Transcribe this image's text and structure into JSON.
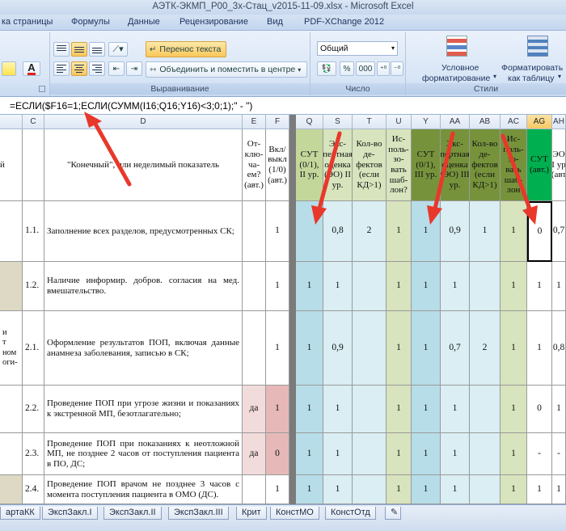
{
  "window": {
    "title": "АЭТК-ЭКМП_Р00_3х-Стац_v2015-11-09.xlsx - Microsoft Excel"
  },
  "ribbon_tabs": [
    "ка страницы",
    "Формулы",
    "Данные",
    "Рецензирование",
    "Вид",
    "PDF-XChange 2012"
  ],
  "ribbon": {
    "wrap_text": "Перенос текста",
    "merge_center": "Объединить и поместить в центре",
    "number_format": "Общий",
    "percent": "%",
    "thousands": "000",
    "cond_format_1": "Условное",
    "cond_format_2": "форматирование",
    "format_table_1": "Форматировать",
    "format_table_2": "как таблицу",
    "group_alignment": "Выравнивание",
    "group_number": "Число",
    "group_styles": "Стили",
    "font_color_letter": "A"
  },
  "formula_bar": {
    "text": "=ЕСЛИ($F16=1;ЕСЛИ(СУММ(I16;Q16;Y16)<3;0;1);\" - \")"
  },
  "columns": [
    {
      "key": "B",
      "label": ""
    },
    {
      "key": "C",
      "label": "C"
    },
    {
      "key": "D",
      "label": "D"
    },
    {
      "key": "E",
      "label": "E"
    },
    {
      "key": "F",
      "label": "F"
    },
    {
      "key": "Q",
      "label": "Q"
    },
    {
      "key": "S",
      "label": "S"
    },
    {
      "key": "T",
      "label": "T"
    },
    {
      "key": "U",
      "label": "U"
    },
    {
      "key": "Y",
      "label": "Y"
    },
    {
      "key": "AA",
      "label": "AA"
    },
    {
      "key": "AB",
      "label": "AB"
    },
    {
      "key": "AC",
      "label": "AC"
    },
    {
      "key": "AG",
      "label": "AG"
    },
    {
      "key": "AH",
      "label": "AH"
    }
  ],
  "header_row": {
    "B": "й",
    "D": "\"Конечный\", или неделимый показатель",
    "E": "От-клю-ча-ем? (авт.)",
    "F": "Вкл/выкл (1/0) (авт.)",
    "Q": "СУТ (0/1), II ур.",
    "S": "Экс-пертная оценка (ЭО) II ур.",
    "T": "Кол-во де-фектов (если КД>1)",
    "U": "Ис-поль-зо-вать шаб-лон?",
    "Y": "СУТ (0/1), III ур.",
    "AA": "Экс-пертная оценка (ЭО) III ур.",
    "AB": "Кол-во де-фектов (если КД>1)",
    "AC": "Ис-поль-зо-вать шаб-лон",
    "AG": "СУТ (авт.)",
    "AH": "ЭО I ур (авт"
  },
  "rows": [
    {
      "B": "",
      "C": "1.1.",
      "D": "Заполнение всех разделов, предусмотренных СК;",
      "E": "",
      "F": "1",
      "Q": "",
      "S": "0,8",
      "T": "2",
      "U": "1",
      "Y": "1",
      "AA": "0,9",
      "AB": "1",
      "AC": "1",
      "AG": "0",
      "AH": "0,7"
    },
    {
      "B": "",
      "C": "1.2.",
      "D": "Наличие информир. добров. согласия на мед. вмешательство.",
      "E": "",
      "F": "1",
      "Q": "1",
      "S": "1",
      "T": "",
      "U": "1",
      "Y": "1",
      "AA": "1",
      "AB": "",
      "AC": "1",
      "AG": "1",
      "AH": "1"
    },
    {
      "B": "и\nт\nном\nоги-",
      "C": "2.1.",
      "D": "Оформление результатов ПОП, включая данные анамнеза заболевания, записью в СК;",
      "E": "",
      "F": "1",
      "Q": "1",
      "S": "0,9",
      "T": "",
      "U": "1",
      "Y": "1",
      "AA": "0,7",
      "AB": "2",
      "AC": "1",
      "AG": "1",
      "AH": "0,8"
    },
    {
      "B": "",
      "C": "2.2.",
      "D": "Проведение ПОП при угрозе жизни и показаниях к экстренной МП, безотлагательно;",
      "E": "да",
      "F": "1",
      "Q": "1",
      "S": "1",
      "T": "",
      "U": "1",
      "Y": "1",
      "AA": "1",
      "AB": "",
      "AC": "1",
      "AG": "0",
      "AH": "1"
    },
    {
      "B": "",
      "C": "2.3.",
      "D": "Проведение ПОП при показаниях к неотложной МП, не позднее 2 часов от поступления пациента в ПО, ДС;",
      "E": "да",
      "F": "0",
      "Q": "1",
      "S": "1",
      "T": "",
      "U": "1",
      "Y": "1",
      "AA": "1",
      "AB": "",
      "AC": "1",
      "AG": "-",
      "AH": "-"
    },
    {
      "B": "",
      "C": "2.4.",
      "D": "Проведение ПОП врачом не позднее 3 часов с момента поступления пациента в ОМО (ДС).",
      "E": "",
      "F": "1",
      "Q": "1",
      "S": "1",
      "T": "",
      "U": "1",
      "Y": "1",
      "AA": "1",
      "AB": "",
      "AC": "1",
      "AG": "1",
      "AH": "1"
    }
  ],
  "sheet_tabs": [
    "артаКК",
    "ЭкспЗакл.I",
    "ЭкспЗакл.II",
    "ЭкспЗакл.III",
    "Крит",
    "КонстМО",
    "КонстОтд"
  ],
  "colors": {
    "light_green": "#d7e4bd",
    "olive_green": "#c4d79b",
    "dark_green": "#76933c",
    "light_blue": "#b7dde8",
    "pale_cyan": "#daeef3",
    "bright_green": "#00b050",
    "pink": "#f2dcdb",
    "dark_pink": "#e6b9b8",
    "tan": "#ddd9c4",
    "arrow_red": "#e8382b"
  }
}
